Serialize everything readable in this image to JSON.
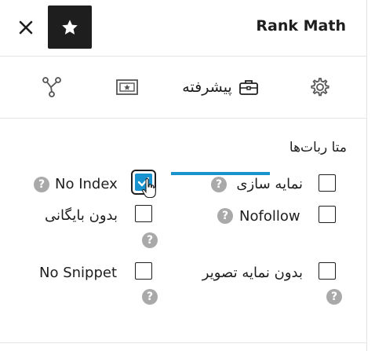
{
  "header": {
    "title": "Rank Math",
    "close_icon": "close-icon",
    "star_icon": "star-icon"
  },
  "tabs": [
    {
      "id": "general",
      "icon": "gear-icon",
      "label": "",
      "active": false
    },
    {
      "id": "advanced",
      "icon": "briefcase-icon",
      "label": "پیشرفته",
      "active": true
    },
    {
      "id": "social",
      "icon": "social-card-icon",
      "label": "",
      "active": false
    },
    {
      "id": "schema",
      "icon": "schema-nodes-icon",
      "label": "",
      "active": false
    }
  ],
  "robots_meta": {
    "title": "متا ربات‌ها",
    "options": {
      "index": {
        "label": "نمایه سازی",
        "checked": false
      },
      "noindex": {
        "label": "No Index",
        "checked": true
      },
      "nofollow": {
        "label": "Nofollow",
        "checked": false
      },
      "noarchive": {
        "label": "بدون بایگانی",
        "checked": false
      },
      "noimageindex": {
        "label": "بدون نمایه تصویر",
        "checked": false
      },
      "nosnippet": {
        "label": "No Snippet",
        "checked": false
      }
    },
    "help_symbol": "?"
  },
  "colors": {
    "accent": "#1993cf",
    "text": "#1e1e1e",
    "help_bg": "#a9a9a9",
    "border": "#e2e4e7"
  }
}
